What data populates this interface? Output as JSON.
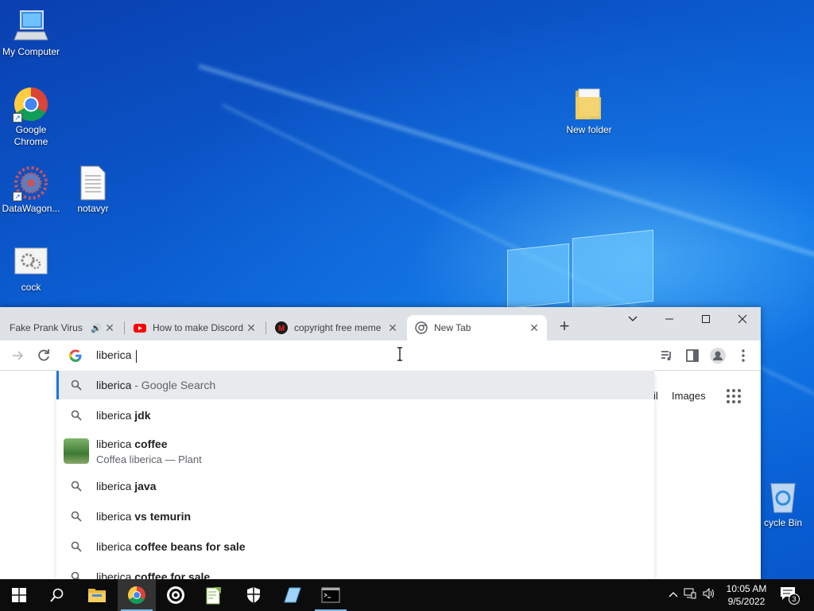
{
  "desktop": {
    "icons": [
      {
        "label": "My Computer",
        "icon": "computer-icon"
      },
      {
        "label": "Google\nChrome",
        "icon": "chrome-icon"
      },
      {
        "label": "DataWagon...",
        "icon": "datawagon-icon"
      },
      {
        "label": "notavyr",
        "icon": "text-file-icon"
      },
      {
        "label": "cock",
        "icon": "settings-file-icon"
      },
      {
        "label": "New folder",
        "icon": "folder-icon"
      },
      {
        "label": "cycle Bin",
        "icon": "recycle-bin-icon"
      }
    ]
  },
  "browser": {
    "tabs": [
      {
        "title": "Fake Prank Virus",
        "audio": true,
        "favicon": "page-icon"
      },
      {
        "title": "How to make Discord",
        "favicon": "youtube-icon"
      },
      {
        "title": "copyright free meme",
        "favicon": "m-logo-icon"
      },
      {
        "title": "New Tab",
        "active": true,
        "favicon": "chrome-icon"
      }
    ],
    "new_tab_label": "+",
    "omnibox": {
      "value": "liberica "
    },
    "suggestions": [
      {
        "prefix": "liberica",
        "bold": "",
        "suffix": " - Google Search",
        "selected": true
      },
      {
        "prefix": "liberica ",
        "bold": "jdk",
        "suffix": ""
      },
      {
        "prefix": "liberica ",
        "bold": "coffee",
        "suffix": "",
        "subtitle": "Coffea liberica — Plant",
        "thumbnail": true
      },
      {
        "prefix": "liberica ",
        "bold": "java",
        "suffix": ""
      },
      {
        "prefix": "liberica ",
        "bold": "vs temurin",
        "suffix": ""
      },
      {
        "prefix": "liberica ",
        "bold": "coffee beans for sale",
        "suffix": ""
      },
      {
        "prefix": "liberica ",
        "bold": "coffee for sale",
        "suffix": ""
      }
    ],
    "ntp_links": {
      "gmail_partial": "il",
      "images": "Images"
    }
  },
  "taskbar": {
    "time": "10:05 AM",
    "date": "9/5/2022",
    "notification_count": "3"
  },
  "colors": {
    "accent": "#1a73e8",
    "taskbar": "#0c0c0c",
    "tabstrip": "#dee1e6"
  }
}
